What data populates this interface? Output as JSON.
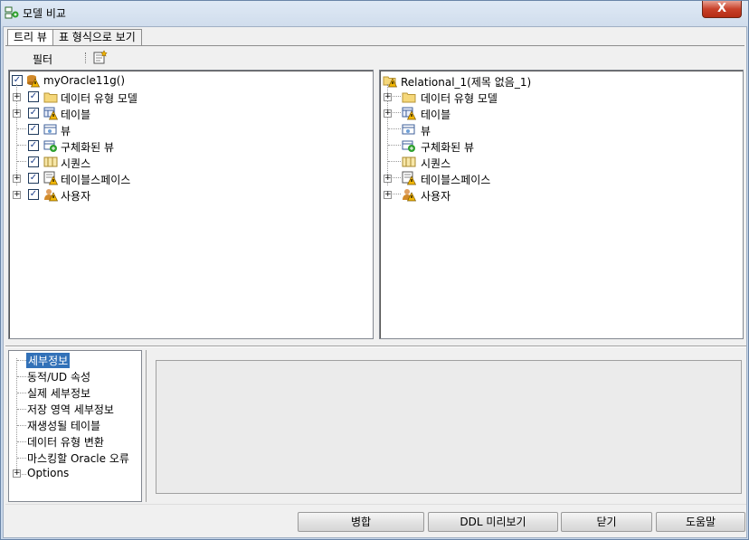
{
  "window": {
    "title": "모델 비교",
    "close_label": "X"
  },
  "tabs": [
    {
      "label": "트리 뷰",
      "active": true
    },
    {
      "label": "표 형식으로 보기",
      "active": false
    }
  ],
  "toolbar": {
    "filter_label": "필터",
    "filter_icon": "new-filter-icon"
  },
  "left_tree": {
    "root": {
      "label": "myOracle11g()",
      "checked": true,
      "icon": "database-warning-icon"
    },
    "items": [
      {
        "label": "데이터 유형 모델",
        "expandable": true,
        "checked": true,
        "icon": "folder-icon"
      },
      {
        "label": "테이블",
        "expandable": true,
        "checked": true,
        "icon": "table-warning-icon"
      },
      {
        "label": "뷰",
        "expandable": false,
        "checked": true,
        "icon": "view-icon"
      },
      {
        "label": "구체화된 뷰",
        "expandable": false,
        "checked": true,
        "icon": "materialized-view-icon"
      },
      {
        "label": "시퀀스",
        "expandable": false,
        "checked": true,
        "icon": "sequence-icon"
      },
      {
        "label": "테이블스페이스",
        "expandable": true,
        "checked": true,
        "icon": "tablespace-warning-icon"
      },
      {
        "label": "사용자",
        "expandable": true,
        "checked": true,
        "icon": "user-warning-icon"
      }
    ]
  },
  "right_tree": {
    "root": {
      "label": "Relational_1(제목 없음_1)",
      "icon": "relational-model-warning-icon"
    },
    "items": [
      {
        "label": "데이터 유형 모델",
        "expandable": true,
        "icon": "folder-icon"
      },
      {
        "label": "테이블",
        "expandable": true,
        "icon": "table-warning-icon"
      },
      {
        "label": "뷰",
        "expandable": false,
        "icon": "view-icon"
      },
      {
        "label": "구체화된 뷰",
        "expandable": false,
        "icon": "materialized-view-icon"
      },
      {
        "label": "시퀀스",
        "expandable": false,
        "icon": "sequence-icon"
      },
      {
        "label": "테이블스페이스",
        "expandable": true,
        "icon": "tablespace-warning-icon"
      },
      {
        "label": "사용자",
        "expandable": true,
        "icon": "user-warning-icon"
      }
    ]
  },
  "nav": {
    "items": [
      {
        "label": "세부정보",
        "selected": true
      },
      {
        "label": "동적/UD 속성",
        "selected": false
      },
      {
        "label": "실제 세부정보",
        "selected": false
      },
      {
        "label": "저장 영역 세부정보",
        "selected": false
      },
      {
        "label": "재생성될 테이블",
        "selected": false
      },
      {
        "label": "데이터 유형 변환",
        "selected": false
      },
      {
        "label": "마스킹할 Oracle 오류",
        "selected": false
      },
      {
        "label": "Options",
        "selected": false,
        "expandable": true
      }
    ]
  },
  "buttons": {
    "merge": "병합",
    "ddl_preview": "DDL 미리보기",
    "close": "닫기",
    "help": "도움말"
  },
  "colors": {
    "selection": "#3271b8",
    "warning": "#f2b705",
    "folder": "#f5d77a"
  }
}
